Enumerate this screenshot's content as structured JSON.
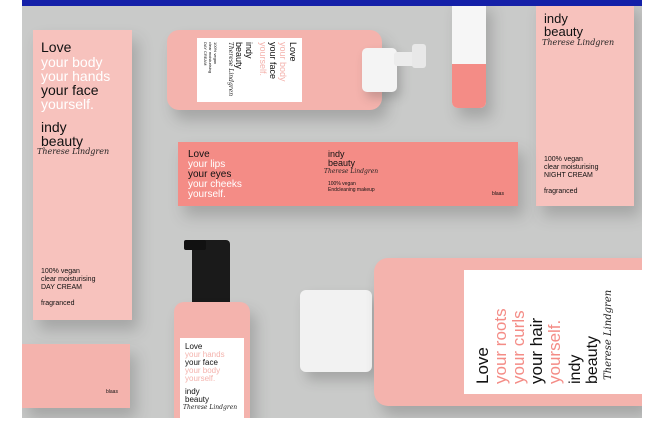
{
  "frame": {
    "accent": "#1420a8",
    "background": "#c9cac9"
  },
  "colors": {
    "pink": "#f4b3ad",
    "coral": "#f48c86",
    "label_white": "#ffffff",
    "ink": "#111111"
  },
  "day_cream_box": {
    "line1": "Love",
    "line2": "your body",
    "line3": "your hands",
    "line4": "your face",
    "line5": "yourself.",
    "brand1": "indy",
    "brand2": "beauty",
    "signature": "Therese Lindgren",
    "desc1": "100% vegan",
    "desc2": "clear moisturising",
    "desc3": "DAY CREAM",
    "variant": "fragranced"
  },
  "pump_bottle_top": {
    "line1": "Love",
    "line2": "your body",
    "line3": "your face",
    "line4": "yourself.",
    "brand1": "indy",
    "brand2": "beauty",
    "signature": "Therese Lindgren",
    "desc1": "100% vegan",
    "desc2": "clear moisturising",
    "desc3": "DAY CREAM"
  },
  "eye_box": {
    "line1": "Love",
    "line2": "your lips",
    "line3": "your eyes",
    "line4": "your cheeks",
    "line5": "yourself.",
    "brand1": "indy",
    "brand2": "beauty",
    "signature": "Therese Lindgren",
    "desc1": "100% vegan",
    "desc2": "Endcleaning makeup",
    "small": "blaas"
  },
  "night_cream_box": {
    "brand1": "indy",
    "brand2": "beauty",
    "signature": "Therese Lindgren",
    "desc1": "100% vegan",
    "desc2": "clear moisturising",
    "desc3": "NIGHT CREAM",
    "variant": "fragranced"
  },
  "pump_bottle_bottom": {
    "line1": "Love",
    "line2": "your hands",
    "line3": "your face",
    "line4": "your body",
    "line5": "yourself.",
    "brand1": "indy",
    "brand2": "beauty",
    "signature": "Therese Lindgren"
  },
  "small_box": {
    "small": "blaas"
  },
  "large_bottle": {
    "line1": "Love",
    "line2": "your roots",
    "line3": "your curls",
    "line4": "your hair",
    "line5": "yourself.",
    "brand1": "indy",
    "brand2": "beauty",
    "signature": "Therese Lindgren"
  }
}
